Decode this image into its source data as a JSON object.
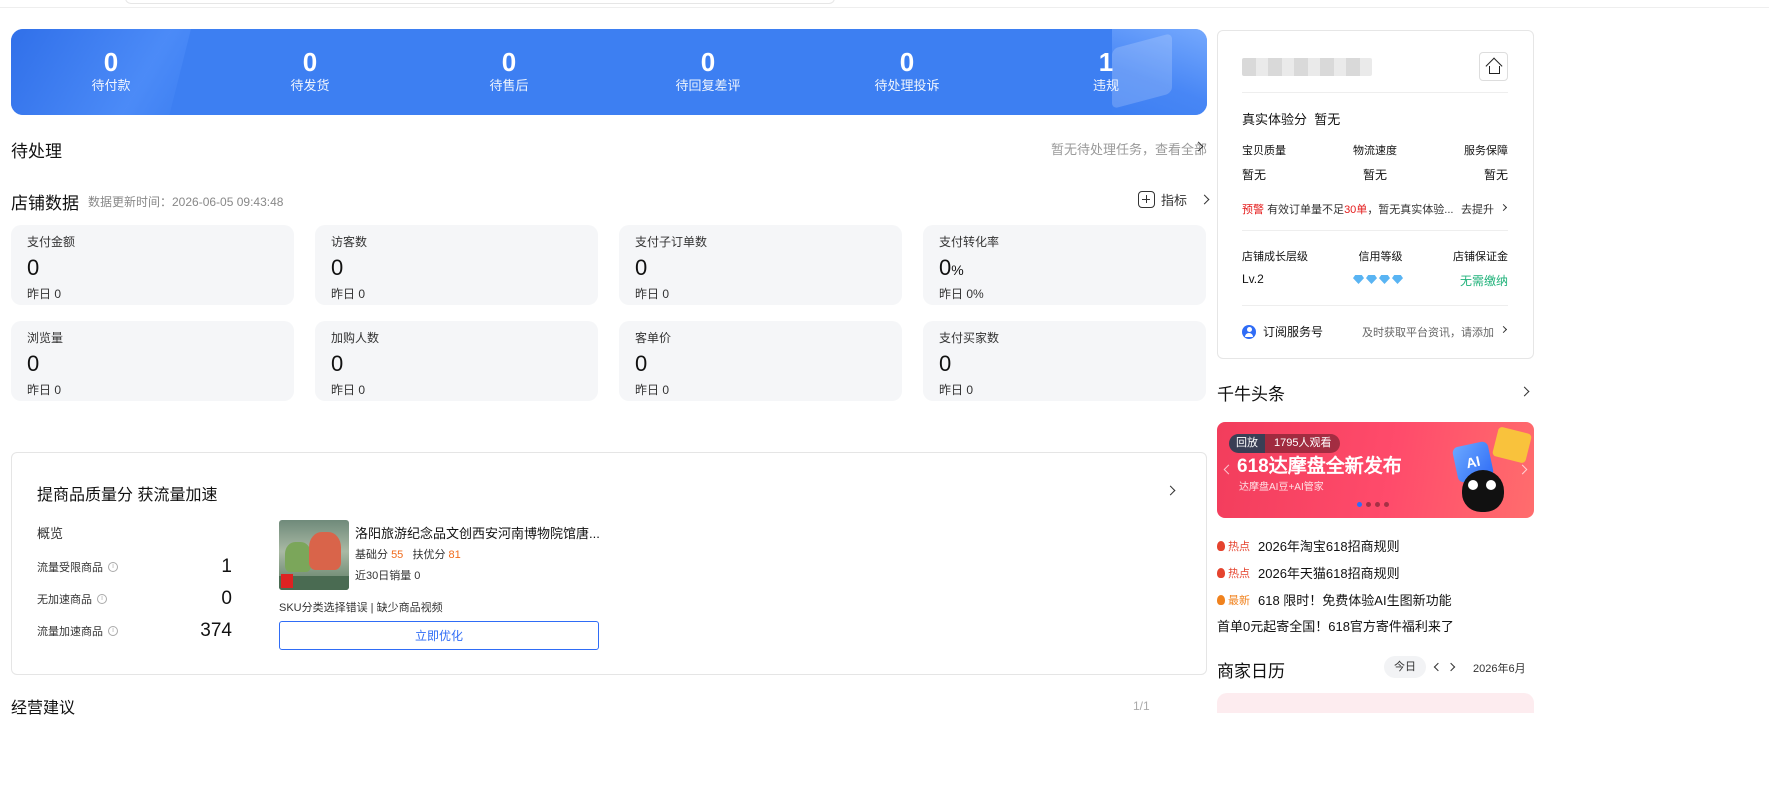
{
  "order_stats": [
    {
      "value": "0",
      "label": "待付款"
    },
    {
      "value": "0",
      "label": "待发货"
    },
    {
      "value": "0",
      "label": "待售后"
    },
    {
      "value": "0",
      "label": "待回复差评"
    },
    {
      "value": "0",
      "label": "待处理投诉"
    },
    {
      "value": "1",
      "label": "违规"
    }
  ],
  "pending": {
    "title": "待处理",
    "link": "暂无待处理任务，查看全部"
  },
  "shop_data": {
    "title": "店铺数据",
    "update_time": "数据更新时间：2026-06-05 09:43:48",
    "metric_link": "指标",
    "cards": [
      {
        "label": "支付金额",
        "value": "0",
        "unit": "",
        "yesterday": "昨日 0"
      },
      {
        "label": "访客数",
        "value": "0",
        "unit": "",
        "yesterday": "昨日 0"
      },
      {
        "label": "支付子订单数",
        "value": "0",
        "unit": "",
        "yesterday": "昨日 0"
      },
      {
        "label": "支付转化率",
        "value": "0",
        "unit": "%",
        "yesterday": "昨日 0%"
      },
      {
        "label": "浏览量",
        "value": "0",
        "unit": "",
        "yesterday": "昨日 0"
      },
      {
        "label": "加购人数",
        "value": "0",
        "unit": "",
        "yesterday": "昨日 0"
      },
      {
        "label": "客单价",
        "value": "0",
        "unit": "",
        "yesterday": "昨日 0"
      },
      {
        "label": "支付买家数",
        "value": "0",
        "unit": "",
        "yesterday": "昨日 0"
      }
    ]
  },
  "quality": {
    "title": "提商品质量分 获流量加速",
    "overview": "概览",
    "rows": [
      {
        "label": "流量受限商品",
        "value": "1"
      },
      {
        "label": "无加速商品",
        "value": "0"
      },
      {
        "label": "流量加速商品",
        "value": "374"
      }
    ],
    "product": {
      "name": "洛阳旅游纪念品文创西安河南博物院馆唐...",
      "base_label": "基础分",
      "base_value": "55",
      "support_label": "扶优分",
      "support_value": "81",
      "sales": "近30日销量 0",
      "issues": "SKU分类选择错误 | 缺少商品视频",
      "button": "立即优化"
    }
  },
  "bottom": {
    "title_cut": "经营建议",
    "pager_cut": "1/1"
  },
  "shop_card": {
    "real_exp_label": "真实体验分",
    "real_exp_value": "暂无",
    "dims": [
      {
        "label": "宝贝质量",
        "value": "暂无"
      },
      {
        "label": "物流速度",
        "value": "暂无"
      },
      {
        "label": "服务保障",
        "value": "暂无"
      }
    ],
    "warn_tag": "预警",
    "warn_text_1": "有效订单量不足",
    "warn_red": "30单",
    "warn_text_2": "，暂无真实体验...",
    "warn_action": "去提升",
    "levels": [
      {
        "label": "店铺成长层级"
      },
      {
        "label": "信用等级"
      },
      {
        "label": "店铺保证金"
      }
    ],
    "level_value": "Lv.2",
    "deposit_value": "无需缴纳",
    "subscribe": "订阅服务号",
    "subscribe_hint": "及时获取平台资讯，请添加"
  },
  "headlines": {
    "title": "千牛头条",
    "promo": {
      "replay": "回放",
      "viewers": "1795人观看",
      "headline": "618达摩盘全新发布",
      "sub": "达摩盘AI豆+AI管家",
      "badge": "AI"
    },
    "news": [
      {
        "tag": "热点",
        "type": "hot",
        "text": "2026年淘宝618招商规则"
      },
      {
        "tag": "热点",
        "type": "hot",
        "text": "2026年天猫618招商规则"
      },
      {
        "tag": "最新",
        "type": "new",
        "text": "618 限时！免费体验AI生图新功能"
      },
      {
        "tag": "",
        "type": "",
        "text": "首单0元起寄全国！618官方寄件福利来了"
      }
    ]
  },
  "calendar": {
    "title": "商家日历",
    "today": "今日",
    "month": "2026年6月"
  }
}
